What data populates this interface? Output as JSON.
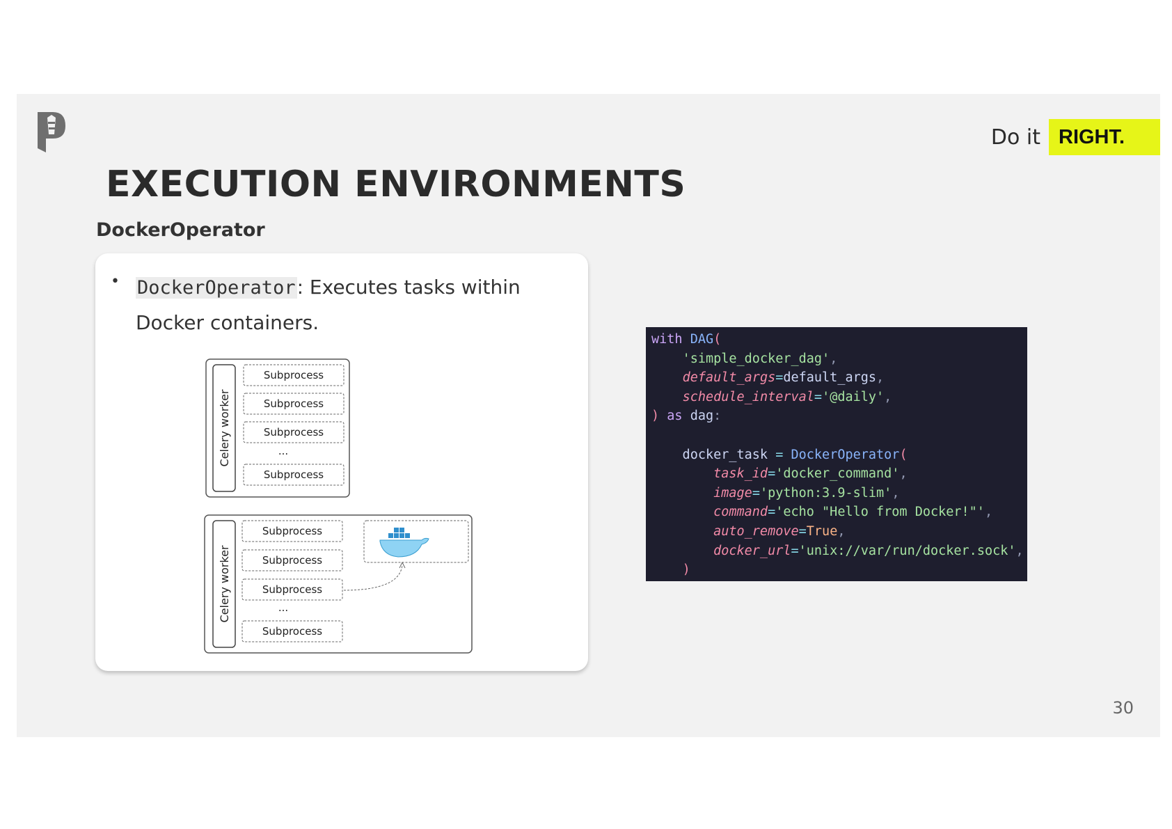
{
  "header": {
    "tagline_prefix": "Do it",
    "tagline_highlight": "RIGHT.",
    "highlight_color": "#e6f518",
    "logo_icon": "lighthouse-logo-icon"
  },
  "title": "EXECUTION ENVIRONMENTS",
  "subtitle": "DockerOperator",
  "card": {
    "bullet_code": "DockerOperator",
    "bullet_text": ": Executes tasks within Docker containers.",
    "diagram": {
      "top_box": {
        "worker_label": "Celery worker",
        "items": [
          "Subprocess",
          "Subprocess",
          "Subprocess",
          "...",
          "Subprocess"
        ]
      },
      "bottom_box": {
        "worker_label": "Celery worker",
        "items": [
          "Subprocess",
          "Subprocess",
          "Subprocess",
          "...",
          "Subprocess"
        ],
        "container_icon": "docker-whale-icon"
      }
    }
  },
  "code": {
    "language": "python",
    "lines": [
      "with DAG(",
      "    'simple_docker_dag',",
      "    default_args=default_args,",
      "    schedule_interval='@daily',",
      ") as dag:",
      "",
      "    docker_task = DockerOperator(",
      "        task_id='docker_command',",
      "        image='python:3.9-slim',",
      "        command='echo \"Hello from Docker!\"',",
      "        auto_remove=True,",
      "        docker_url='unix://var/run/docker.sock',",
      "    )"
    ]
  },
  "page_number": "30"
}
